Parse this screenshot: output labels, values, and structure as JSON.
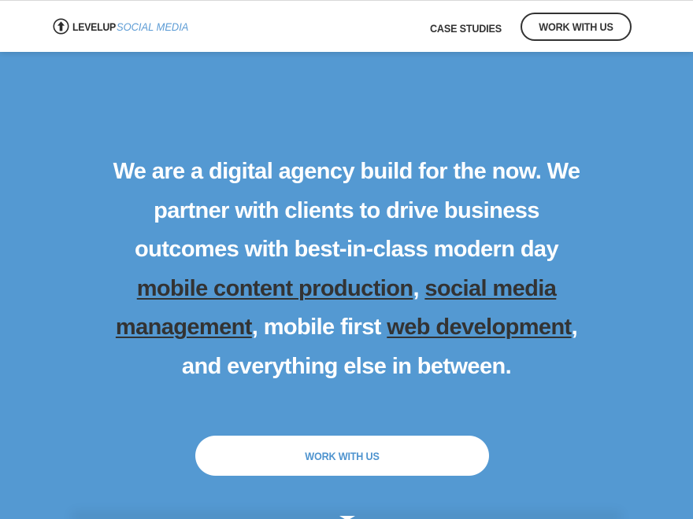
{
  "header": {
    "logo": {
      "icon": "arrow-up-circle-icon",
      "brand_bold": "LEVELUP",
      "brand_italic": "SOCIAL MEDIA"
    },
    "nav": {
      "case_studies_label": "CASE STUDIES",
      "work_with_us_label": "WORK WITH US"
    }
  },
  "hero": {
    "text_part1": "We are a digital agency build for the now. We partner with clients to drive business outcomes with best-in-class modern day ",
    "link_mobile_content": "mobile content production",
    "sep1": ", ",
    "link_social_media": "social media management",
    "text_part2": ", mobile first ",
    "link_web_dev": "web development",
    "text_part3": ", and everything else in between.",
    "cta_label": "WORK WITH US"
  },
  "colors": {
    "hero_background": "#5499d2",
    "brand_accent": "#5b9bd5",
    "dark_text": "#333333",
    "white": "#ffffff"
  },
  "icons": {
    "scroll_indicator": "chevron-down-icon"
  }
}
